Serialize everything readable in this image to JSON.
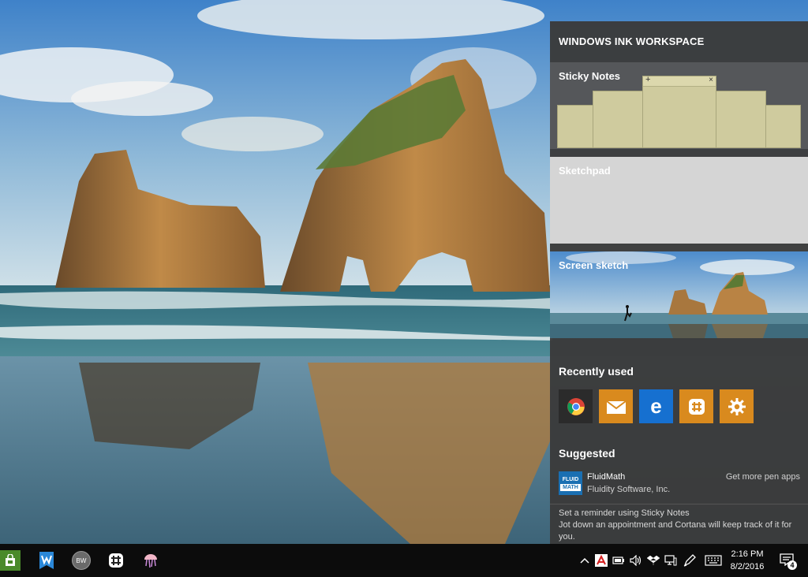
{
  "panel": {
    "title": "WINDOWS INK WORKSPACE",
    "sticky_notes_label": "Sticky Notes",
    "sketchpad_label": "Sketchpad",
    "screen_sketch_label": "Screen sketch",
    "recently_used_label": "Recently used",
    "recent_apps": [
      {
        "icon": "chrome-icon",
        "color": "#2b2b2b"
      },
      {
        "icon": "mail-icon",
        "color": "#d98a1e"
      },
      {
        "icon": "edge-icon",
        "color": "#1670d0"
      },
      {
        "icon": "slack-icon",
        "color": "#d98a1e"
      },
      {
        "icon": "settings-gear-icon",
        "color": "#d98a1e"
      }
    ],
    "suggested_label": "Suggested",
    "suggested_app": {
      "logo_line1": "FLUID",
      "logo_line2": "MATH",
      "name": "FluidMath",
      "publisher": "Fluidity Software, Inc."
    },
    "get_more_label": "Get more pen apps",
    "tip_title": "Set a reminder using Sticky Notes",
    "tip_body": "Jot down an appointment and Cortana will keep track of it for you."
  },
  "taskbar": {
    "pinned": [
      {
        "icon": "store-icon"
      },
      {
        "icon": "wunderlist-icon"
      },
      {
        "icon": "bw-avatar-icon",
        "text": "BW"
      },
      {
        "icon": "slack-icon"
      },
      {
        "icon": "jellyfish-icon"
      }
    ],
    "time": "2:16 PM",
    "date": "8/2/2016",
    "notification_count": "4"
  },
  "colors": {
    "panel_bg": "#3a3a3a",
    "sticky_note": "#cfcb9e",
    "accent_orange": "#d98a1e",
    "accent_blue": "#1670d0"
  }
}
